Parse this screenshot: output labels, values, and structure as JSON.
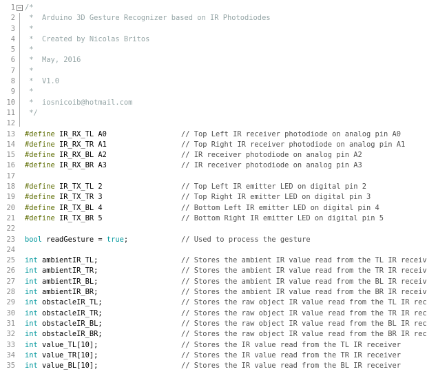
{
  "editor": {
    "lines": [
      {
        "n": "1",
        "code": [
          {
            "t": "/*",
            "c": "doc"
          }
        ],
        "comment": ""
      },
      {
        "n": "2",
        "code": [
          {
            "t": " *  Arduino 3D Gesture Recognizer based on IR Photodiodes",
            "c": "doc"
          }
        ],
        "comment": ""
      },
      {
        "n": "3",
        "code": [
          {
            "t": " *",
            "c": "doc"
          }
        ],
        "comment": ""
      },
      {
        "n": "4",
        "code": [
          {
            "t": " *  Created by Nicolas Britos",
            "c": "doc"
          }
        ],
        "comment": ""
      },
      {
        "n": "5",
        "code": [
          {
            "t": " *",
            "c": "doc"
          }
        ],
        "comment": ""
      },
      {
        "n": "6",
        "code": [
          {
            "t": " *  May, 2016",
            "c": "doc"
          }
        ],
        "comment": ""
      },
      {
        "n": "7",
        "code": [
          {
            "t": " *",
            "c": "doc"
          }
        ],
        "comment": ""
      },
      {
        "n": "8",
        "code": [
          {
            "t": " *  V1.0",
            "c": "doc"
          }
        ],
        "comment": ""
      },
      {
        "n": "9",
        "code": [
          {
            "t": " *",
            "c": "doc"
          }
        ],
        "comment": ""
      },
      {
        "n": "10",
        "code": [
          {
            "t": " *  iosnicoib@hotmail.com",
            "c": "doc"
          }
        ],
        "comment": ""
      },
      {
        "n": "11",
        "code": [
          {
            "t": " */",
            "c": "doc"
          }
        ],
        "comment": ""
      },
      {
        "n": "12",
        "code": [],
        "comment": ""
      },
      {
        "n": "13",
        "code": [
          {
            "t": "#define",
            "c": "pp"
          },
          {
            "t": " IR_RX_TL A0",
            "c": "txt"
          }
        ],
        "comment": "// Top Left IR receiver photodiode on analog pin A0"
      },
      {
        "n": "14",
        "code": [
          {
            "t": "#define",
            "c": "pp"
          },
          {
            "t": " IR_RX_TR A1",
            "c": "txt"
          }
        ],
        "comment": "// Top Right IR receiver photodiode on analog pin A1"
      },
      {
        "n": "15",
        "code": [
          {
            "t": "#define",
            "c": "pp"
          },
          {
            "t": " IR_RX_BL A2",
            "c": "txt"
          }
        ],
        "comment": "// IR receiver photodiode on analog pin A2"
      },
      {
        "n": "16",
        "code": [
          {
            "t": "#define",
            "c": "pp"
          },
          {
            "t": " IR_RX_BR A3",
            "c": "txt"
          }
        ],
        "comment": "// IR receiver photodiode on analog pin A3"
      },
      {
        "n": "17",
        "code": [],
        "comment": ""
      },
      {
        "n": "18",
        "code": [
          {
            "t": "#define",
            "c": "pp"
          },
          {
            "t": " IR_TX_TL 2",
            "c": "txt"
          }
        ],
        "comment": "// Top Left IR emitter LED on digital pin 2"
      },
      {
        "n": "19",
        "code": [
          {
            "t": "#define",
            "c": "pp"
          },
          {
            "t": " IR_TX_TR 3",
            "c": "txt"
          }
        ],
        "comment": "// Top Right IR emitter LED on digital pin 3"
      },
      {
        "n": "20",
        "code": [
          {
            "t": "#define",
            "c": "pp"
          },
          {
            "t": " IR_TX_BL 4",
            "c": "txt"
          }
        ],
        "comment": "// Bottom Left IR emitter LED on digital pin 4"
      },
      {
        "n": "21",
        "code": [
          {
            "t": "#define",
            "c": "pp"
          },
          {
            "t": " IR_TX_BR 5",
            "c": "txt"
          }
        ],
        "comment": "// Bottom Right IR emitter LED on digital pin 5"
      },
      {
        "n": "22",
        "code": [],
        "comment": ""
      },
      {
        "n": "23",
        "code": [
          {
            "t": "bool",
            "c": "kw"
          },
          {
            "t": " readGesture = ",
            "c": "txt"
          },
          {
            "t": "true",
            "c": "lit"
          },
          {
            "t": ";",
            "c": "txt"
          }
        ],
        "comment": "// Used to process the gesture"
      },
      {
        "n": "24",
        "code": [],
        "comment": ""
      },
      {
        "n": "25",
        "code": [
          {
            "t": "int",
            "c": "kw"
          },
          {
            "t": " ambientIR_TL;",
            "c": "txt"
          }
        ],
        "comment": "// Stores the ambient IR value read from the TL IR receiver"
      },
      {
        "n": "26",
        "code": [
          {
            "t": "int",
            "c": "kw"
          },
          {
            "t": " ambientIR_TR;",
            "c": "txt"
          }
        ],
        "comment": "// Stores the ambient IR value read from the TR IR receiver"
      },
      {
        "n": "27",
        "code": [
          {
            "t": "int",
            "c": "kw"
          },
          {
            "t": " ambientIR_BL;",
            "c": "txt"
          }
        ],
        "comment": "// Stores the ambient IR value read from the BL IR receiver"
      },
      {
        "n": "28",
        "code": [
          {
            "t": "int",
            "c": "kw"
          },
          {
            "t": " ambientIR_BR;",
            "c": "txt"
          }
        ],
        "comment": "// Stores the ambient IR value read from the BR IR receiver"
      },
      {
        "n": "29",
        "code": [
          {
            "t": "int",
            "c": "kw"
          },
          {
            "t": " obstacleIR_TL;",
            "c": "txt"
          }
        ],
        "comment": "// Stores the raw object IR value read from the TL IR receiver"
      },
      {
        "n": "30",
        "code": [
          {
            "t": "int",
            "c": "kw"
          },
          {
            "t": " obstacleIR_TR;",
            "c": "txt"
          }
        ],
        "comment": "// Stores the raw object IR value read from the TR IR receiver"
      },
      {
        "n": "31",
        "code": [
          {
            "t": "int",
            "c": "kw"
          },
          {
            "t": " obstacleIR_BL;",
            "c": "txt"
          }
        ],
        "comment": "// Stores the raw object IR value read from the BL IR receiver"
      },
      {
        "n": "32",
        "code": [
          {
            "t": "int",
            "c": "kw"
          },
          {
            "t": " obstacleIR_BR;",
            "c": "txt"
          }
        ],
        "comment": "// Stores the raw object IR value read from the BR IR receiver"
      },
      {
        "n": "33",
        "code": [
          {
            "t": "int",
            "c": "kw"
          },
          {
            "t": " value_TL[10];",
            "c": "txt"
          }
        ],
        "comment": "// Stores the IR value read from the TL IR receiver"
      },
      {
        "n": "34",
        "code": [
          {
            "t": "int",
            "c": "kw"
          },
          {
            "t": " value_TR[10];",
            "c": "txt"
          }
        ],
        "comment": "// Stores the IR value read from the TR IR receiver"
      },
      {
        "n": "35",
        "code": [
          {
            "t": "int",
            "c": "kw"
          },
          {
            "t": " value_BL[10];",
            "c": "txt"
          }
        ],
        "comment": "// Stores the IR value read from the BL IR receiver"
      }
    ]
  }
}
